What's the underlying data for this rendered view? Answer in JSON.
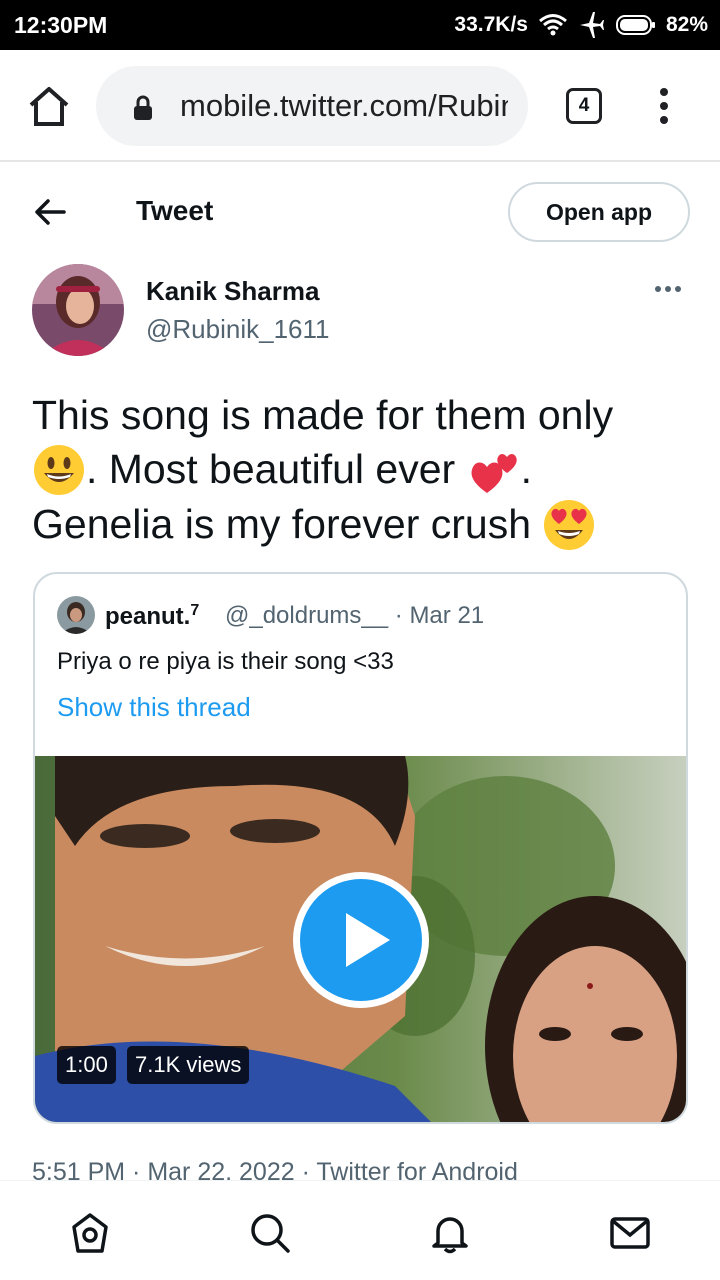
{
  "status_bar": {
    "time": "12:30PM",
    "network_speed": "33.7K/s",
    "battery": "82%"
  },
  "browser": {
    "url": "mobile.twitter.com/Rubinik_1611",
    "tab_count": "4"
  },
  "header": {
    "title": "Tweet",
    "open_app_label": "Open app"
  },
  "tweet": {
    "author_name": "Kanik Sharma",
    "author_handle": "@Rubinik_1611",
    "text_line1": "This song is made for them only",
    "text_line2": ". Most beautiful ever",
    "text_line2_end": ".",
    "text_line3": "Genelia is my forever crush",
    "meta": "5:51 PM · Mar 22, 2022 · Twitter for Android"
  },
  "quoted_tweet": {
    "author_name": "peanut.",
    "author_superscript": "7",
    "author_handle": "@_doldrums__ · Mar 21",
    "text": "Priya o re piya is their song <33",
    "show_thread_label": "Show this thread",
    "video_duration": "1:00",
    "video_views": "7.1K views"
  },
  "colors": {
    "accent": "#1d9bf0",
    "secondary_text": "#536471",
    "primary_text": "#0f1419",
    "border": "#cfd9de"
  },
  "icons": {
    "home": "home-icon",
    "search": "search-icon",
    "notifications": "bell-icon",
    "messages": "mail-icon"
  }
}
